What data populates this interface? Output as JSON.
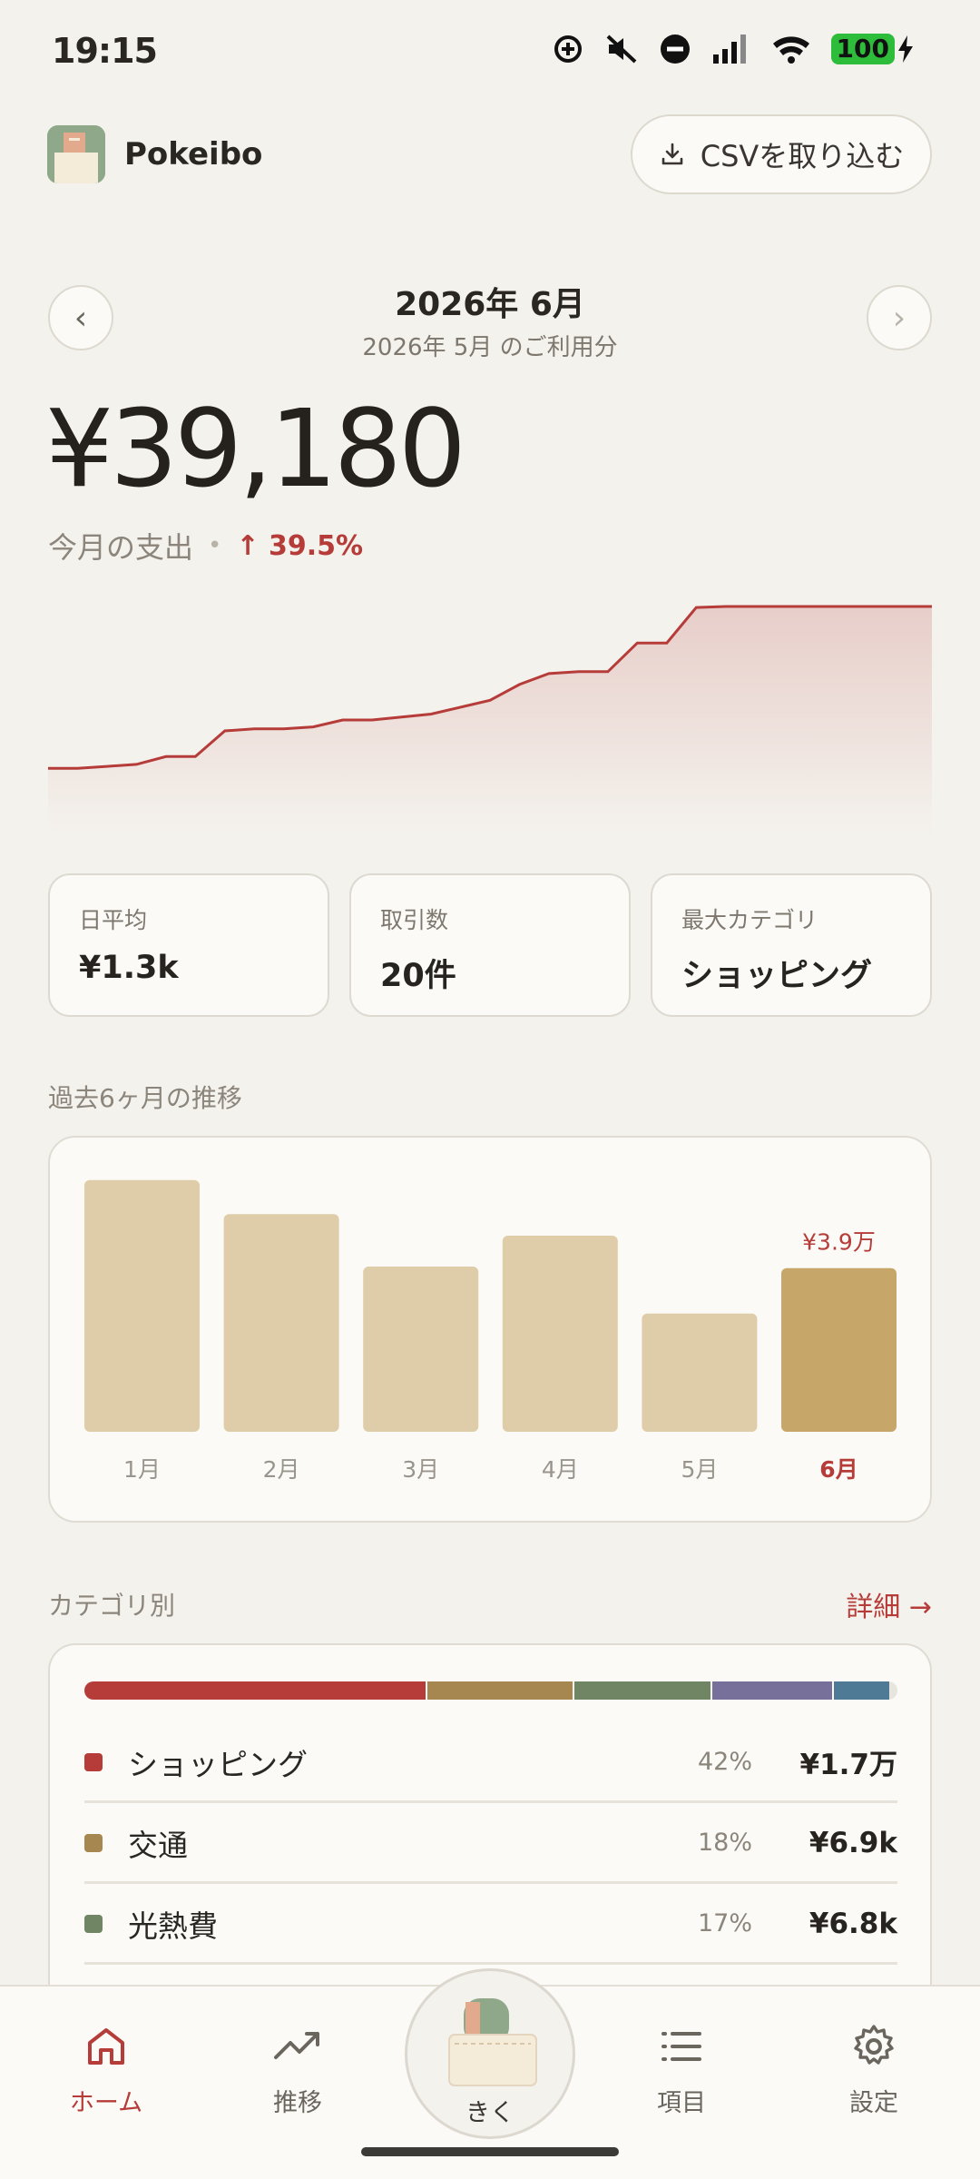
{
  "status_bar": {
    "time": "19:15",
    "battery": "100",
    "icons": [
      "data-saver-icon",
      "mute-icon",
      "dnd-icon",
      "signal-icon",
      "wifi-icon",
      "battery-icon",
      "charging-icon"
    ]
  },
  "header": {
    "app_name": "Pokeibo",
    "import_button": "CSVを取り込む"
  },
  "month_nav": {
    "title": "2026年 6月",
    "subtitle": "2026年 5月 のご利用分",
    "prev": "‹",
    "next": "›"
  },
  "summary": {
    "total": "¥39,180",
    "label": "今月の支出",
    "separator": "•",
    "change": "↑ 39.5%"
  },
  "cumulative_chart": {
    "values": [
      3.1,
      3.1,
      3.3,
      3.5,
      4.3,
      4.3,
      6.9,
      7.1,
      7.1,
      7.3,
      8.0,
      8.0,
      8.3,
      8.6,
      9.3,
      10.0,
      11.6,
      12.7,
      12.9,
      12.9,
      15.8,
      15.8,
      19.4,
      19.5,
      19.5,
      19.5,
      19.5,
      19.5,
      19.5,
      19.5,
      19.5
    ],
    "color": "#b63c3a"
  },
  "stats": [
    {
      "label": "日平均",
      "value": "¥1.3k"
    },
    {
      "label": "取引数",
      "value": "20件"
    },
    {
      "label": "最大カテゴリ",
      "value": "ショッピング"
    }
  ],
  "trend": {
    "title": "過去6ヶ月の推移"
  },
  "chart_data": {
    "type": "bar",
    "categories": [
      "1月",
      "2月",
      "3月",
      "4月",
      "5月",
      "6月"
    ],
    "values": [
      46.6,
      40.3,
      30.6,
      36.3,
      21.9,
      30.3
    ],
    "highlight_label": "¥3.9万",
    "colors": {
      "normal": "#dfcda9",
      "highlight": "#c7a66a",
      "highlight_text": "#b63c3a"
    }
  },
  "categories": {
    "title": "カテゴリ別",
    "detail_link": "詳細 →",
    "stack": [
      {
        "color": "#b63c3a",
        "pct": 42
      },
      {
        "color": "#a6874f",
        "pct": 18
      },
      {
        "color": "#6f8563",
        "pct": 17
      },
      {
        "color": "#77709a",
        "pct": 15
      },
      {
        "color": "#4f7a96",
        "pct": 7
      }
    ],
    "rows": [
      {
        "name": "ショッピング",
        "pct": "42%",
        "amount": "¥1.7万",
        "color": "#b63c3a"
      },
      {
        "name": "交通",
        "pct": "18%",
        "amount": "¥6.9k",
        "color": "#a6874f"
      },
      {
        "name": "光熱費",
        "pct": "17%",
        "amount": "¥6.8k",
        "color": "#6f8563"
      }
    ]
  },
  "bottom_nav": {
    "home": "ホーム",
    "trend": "推移",
    "ask": "きく",
    "items": "項目",
    "settings": "設定"
  }
}
